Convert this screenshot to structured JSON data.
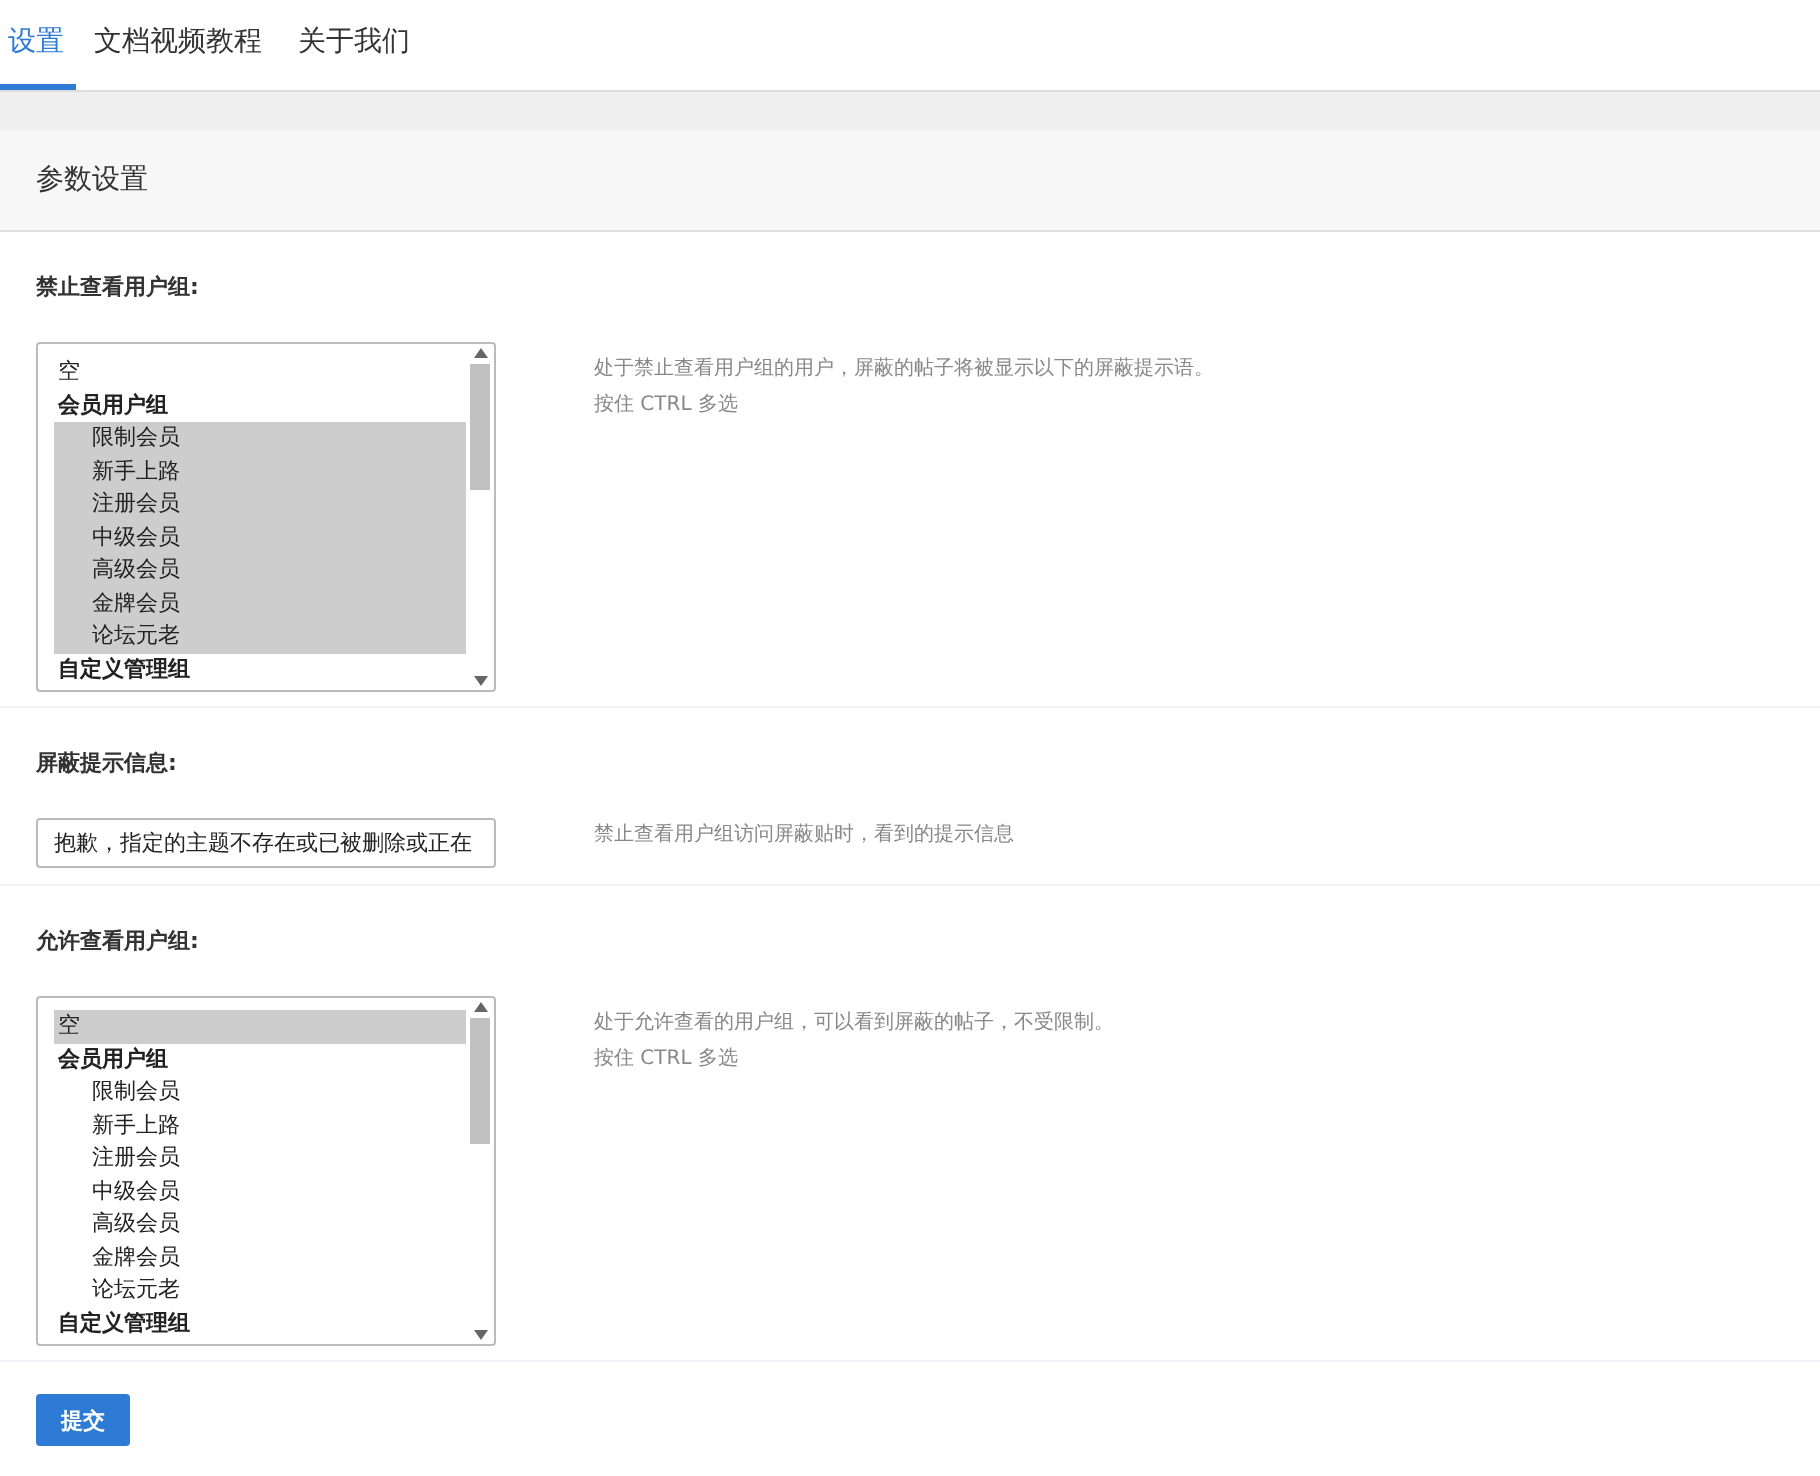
{
  "tabs": [
    {
      "label": "设置",
      "selected": true
    },
    {
      "label": "文档视频教程",
      "selected": false
    },
    {
      "label": "关于我们",
      "selected": false
    }
  ],
  "panel": {
    "title": "参数设置",
    "sections": [
      {
        "kind": "multiselect",
        "label": "禁止查看用户组:",
        "hints": [
          "处于禁止查看用户组的用户，屏蔽的帖子将被显示以下的屏蔽提示语。",
          "按住 CTRL 多选"
        ],
        "options": [
          {
            "label": "空",
            "kind": "plain",
            "selected": false
          },
          {
            "label": "会员用户组",
            "kind": "group",
            "selected": false
          },
          {
            "label": "限制会员",
            "kind": "member",
            "selected": true
          },
          {
            "label": "新手上路",
            "kind": "member",
            "selected": true
          },
          {
            "label": "注册会员",
            "kind": "member",
            "selected": true
          },
          {
            "label": "中级会员",
            "kind": "member",
            "selected": true
          },
          {
            "label": "高级会员",
            "kind": "member",
            "selected": true
          },
          {
            "label": "金牌会员",
            "kind": "member",
            "selected": true
          },
          {
            "label": "论坛元老",
            "kind": "member",
            "selected": true
          },
          {
            "label": "自定义管理组",
            "kind": "group",
            "selected": false
          }
        ]
      },
      {
        "kind": "text",
        "label": "屏蔽提示信息:",
        "value": "抱歉，指定的主题不存在或已被删除或正在",
        "hints": [
          "禁止查看用户组访问屏蔽贴时，看到的提示信息"
        ]
      },
      {
        "kind": "multiselect",
        "label": "允许查看用户组:",
        "hints": [
          "处于允许查看的用户组，可以看到屏蔽的帖子，不受限制。",
          "按住 CTRL 多选"
        ],
        "options": [
          {
            "label": "空",
            "kind": "plain",
            "selected": true
          },
          {
            "label": "会员用户组",
            "kind": "group",
            "selected": false
          },
          {
            "label": "限制会员",
            "kind": "member",
            "selected": false
          },
          {
            "label": "新手上路",
            "kind": "member",
            "selected": false
          },
          {
            "label": "注册会员",
            "kind": "member",
            "selected": false
          },
          {
            "label": "中级会员",
            "kind": "member",
            "selected": false
          },
          {
            "label": "高级会员",
            "kind": "member",
            "selected": false
          },
          {
            "label": "金牌会员",
            "kind": "member",
            "selected": false
          },
          {
            "label": "论坛元老",
            "kind": "member",
            "selected": false
          },
          {
            "label": "自定义管理组",
            "kind": "group",
            "selected": false
          }
        ]
      }
    ]
  },
  "submit": "提交"
}
